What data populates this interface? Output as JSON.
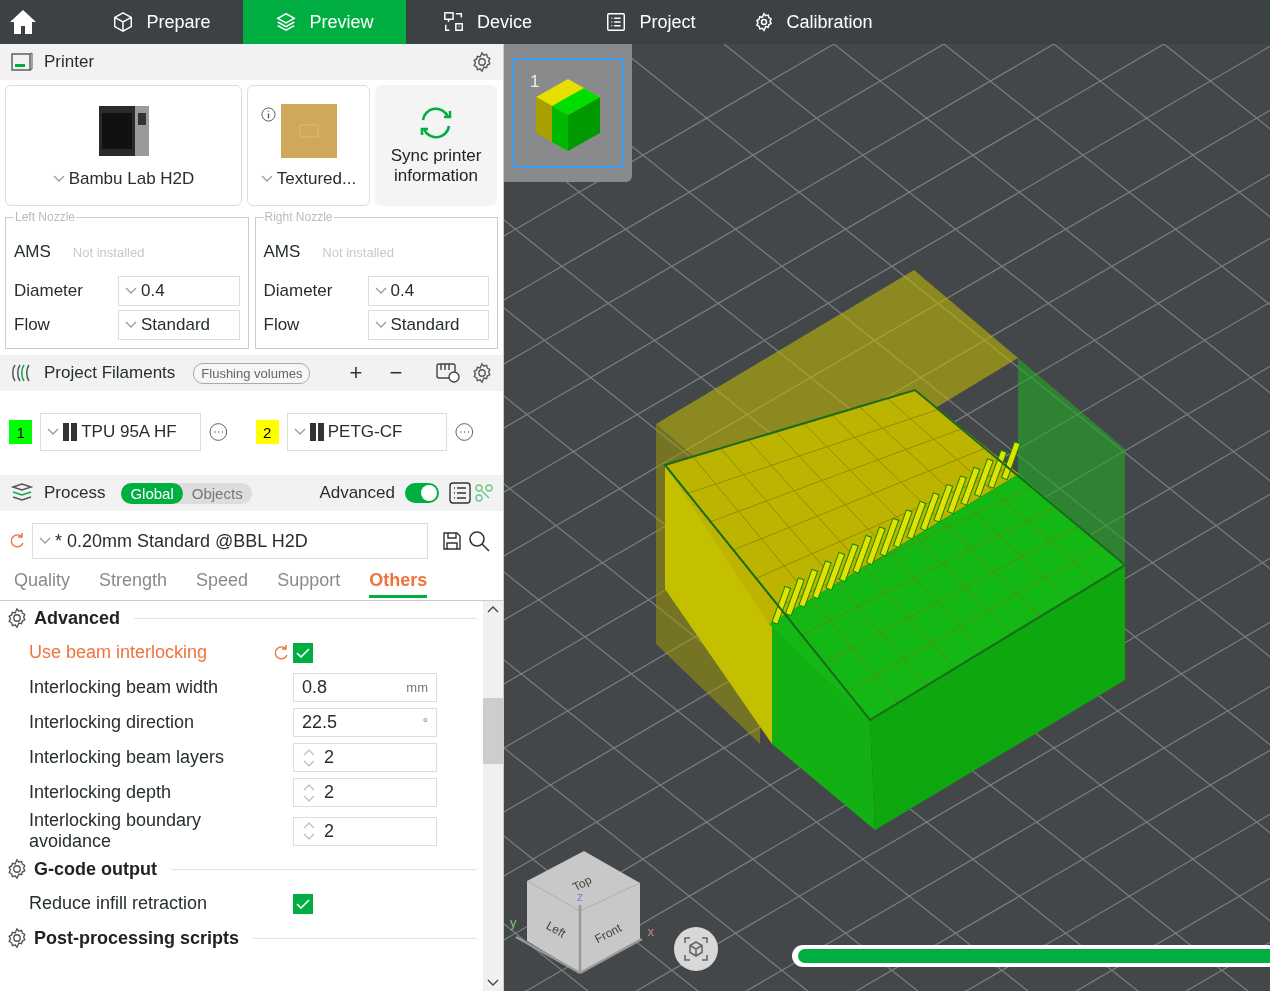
{
  "nav": {
    "tabs": [
      {
        "label": "Prepare",
        "selected": false
      },
      {
        "label": "Preview",
        "selected": true
      },
      {
        "label": "Device",
        "selected": false
      },
      {
        "label": "Project",
        "selected": false
      },
      {
        "label": "Calibration",
        "selected": false
      }
    ]
  },
  "printer": {
    "title": "Printer",
    "printer_name": "Bambu Lab H2D",
    "plate": "Textured...",
    "sync": "Sync printer information",
    "nozzles": [
      {
        "legend": "Left Nozzle",
        "ams_label": "AMS",
        "ams_status": "Not installed",
        "diameter_label": "Diameter",
        "diameter": "0.4",
        "flow_label": "Flow",
        "flow": "Standard"
      },
      {
        "legend": "Right Nozzle",
        "ams_label": "AMS",
        "ams_status": "Not installed",
        "diameter_label": "Diameter",
        "diameter": "0.4",
        "flow_label": "Flow",
        "flow": "Standard"
      }
    ]
  },
  "filaments": {
    "title": "Project Filaments",
    "flushing": "Flushing volumes",
    "add": "+",
    "remove": "−",
    "items": [
      {
        "index": "1",
        "color": "#00ff00",
        "name": "TPU 95A HF"
      },
      {
        "index": "2",
        "color": "#ffff00",
        "name": "PETG-CF"
      }
    ]
  },
  "process": {
    "title": "Process",
    "scope": [
      {
        "label": "Global",
        "selected": true
      },
      {
        "label": "Objects",
        "selected": false
      }
    ],
    "advanced_label": "Advanced",
    "advanced_on": true,
    "preset": "* 0.20mm Standard @BBL H2D",
    "tabs": [
      {
        "label": "Quality",
        "selected": false
      },
      {
        "label": "Strength",
        "selected": false
      },
      {
        "label": "Speed",
        "selected": false
      },
      {
        "label": "Support",
        "selected": false
      },
      {
        "label": "Others",
        "selected": true
      }
    ],
    "groups": [
      {
        "title": "Advanced",
        "options": [
          {
            "kind": "checkbox",
            "label": "Use beam interlocking",
            "modified": true,
            "checked": true
          },
          {
            "kind": "unit",
            "label": "Interlocking beam width",
            "modified": false,
            "value": "0.8",
            "unit": "mm"
          },
          {
            "kind": "unit",
            "label": "Interlocking direction",
            "modified": false,
            "value": "22.5",
            "unit": "°"
          },
          {
            "kind": "spin",
            "label": "Interlocking beam layers",
            "modified": false,
            "value": "2"
          },
          {
            "kind": "spin",
            "label": "Interlocking depth",
            "modified": false,
            "value": "2"
          },
          {
            "kind": "spin",
            "label": "Interlocking boundary avoidance",
            "modified": false,
            "value": "2"
          }
        ]
      },
      {
        "title": "G-code output",
        "options": [
          {
            "kind": "checkbox",
            "label": "Reduce infill retraction",
            "modified": false,
            "checked": true
          }
        ]
      },
      {
        "title": "Post-processing scripts"
      }
    ]
  },
  "viewport": {
    "thumbnail": {
      "label": "1",
      "selected": true
    },
    "view_cube": {
      "faces": [
        "Top",
        "Left",
        "Front"
      ],
      "axes": [
        "x",
        "y",
        "z"
      ]
    },
    "moves_slider": {
      "level": 1
    }
  }
}
